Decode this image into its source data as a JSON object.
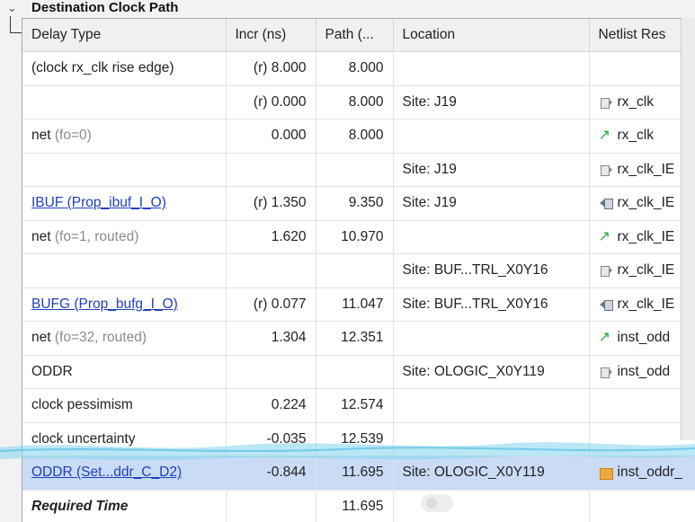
{
  "section": {
    "title": "Destination Clock Path"
  },
  "columns": [
    "Delay Type",
    "Incr (ns)",
    "Path (...",
    "Location",
    "Netlist Res"
  ],
  "rows": [
    {
      "delay_type": "(clock rx_clk rise edge)",
      "fo": "",
      "link": false,
      "incr": "(r) 8.000",
      "path": "8.000",
      "location": "",
      "netlist": "",
      "icon": ""
    },
    {
      "delay_type": "",
      "fo": "",
      "link": false,
      "incr": "(r) 0.000",
      "path": "8.000",
      "location": "Site: J19",
      "netlist": "rx_clk",
      "icon": "port-icon"
    },
    {
      "delay_type": "net",
      "fo": "(fo=0)",
      "link": false,
      "incr": "0.000",
      "path": "8.000",
      "location": "",
      "netlist": "rx_clk",
      "icon": "net-arrow-icon"
    },
    {
      "delay_type": "",
      "fo": "",
      "link": false,
      "incr": "",
      "path": "",
      "location": "Site: J19",
      "netlist": "rx_clk_IE",
      "icon": "port-icon"
    },
    {
      "delay_type": "IBUF (Prop_ibuf_I_O)",
      "fo": "",
      "link": true,
      "incr": "(r) 1.350",
      "path": "9.350",
      "location": "Site: J19",
      "netlist": "rx_clk_IE",
      "icon": "input-pin-icon"
    },
    {
      "delay_type": "net",
      "fo": "(fo=1, routed)",
      "link": false,
      "incr": "1.620",
      "path": "10.970",
      "location": "",
      "netlist": "rx_clk_IE",
      "icon": "net-arrow-icon"
    },
    {
      "delay_type": "",
      "fo": "",
      "link": false,
      "incr": "",
      "path": "",
      "location": "Site: BUF...TRL_X0Y16",
      "netlist": "rx_clk_IE",
      "icon": "port-icon"
    },
    {
      "delay_type": "BUFG (Prop_bufg_I_O)",
      "fo": "",
      "link": true,
      "incr": "(r) 0.077",
      "path": "11.047",
      "location": "Site: BUF...TRL_X0Y16",
      "netlist": "rx_clk_IE",
      "icon": "input-pin-icon"
    },
    {
      "delay_type": "net",
      "fo": "(fo=32, routed)",
      "link": false,
      "incr": "1.304",
      "path": "12.351",
      "location": "",
      "netlist": "inst_odd",
      "icon": "net-arrow-icon"
    },
    {
      "delay_type": "ODDR",
      "fo": "",
      "link": false,
      "incr": "",
      "path": "",
      "location": "Site: OLOGIC_X0Y119",
      "netlist": "inst_odd",
      "icon": "port-icon"
    },
    {
      "delay_type": "clock pessimism",
      "fo": "",
      "link": false,
      "incr": "0.224",
      "path": "12.574",
      "location": "",
      "netlist": "",
      "icon": ""
    },
    {
      "delay_type": "clock uncertainty",
      "fo": "",
      "link": false,
      "incr": "-0.035",
      "path": "12.539",
      "location": "",
      "netlist": "",
      "icon": ""
    },
    {
      "delay_type": "ODDR (Set...ddr_C_D2)",
      "fo": "",
      "link": true,
      "incr": "-0.844",
      "path": "11.695",
      "location": "Site: OLOGIC_X0Y119",
      "netlist": "inst_oddr_",
      "icon": "cell-icon",
      "selected": true
    },
    {
      "delay_type": "Required Time",
      "fo": "",
      "link": false,
      "incr": "",
      "path": "11.695",
      "location": "",
      "netlist": "",
      "icon": "",
      "emphasis": true
    }
  ],
  "colors": {
    "link": "#1f3fc0",
    "selected_row": "#c9dbf5",
    "net_arrow": "#2aa63a",
    "cell_icon": "#f2a93b"
  }
}
